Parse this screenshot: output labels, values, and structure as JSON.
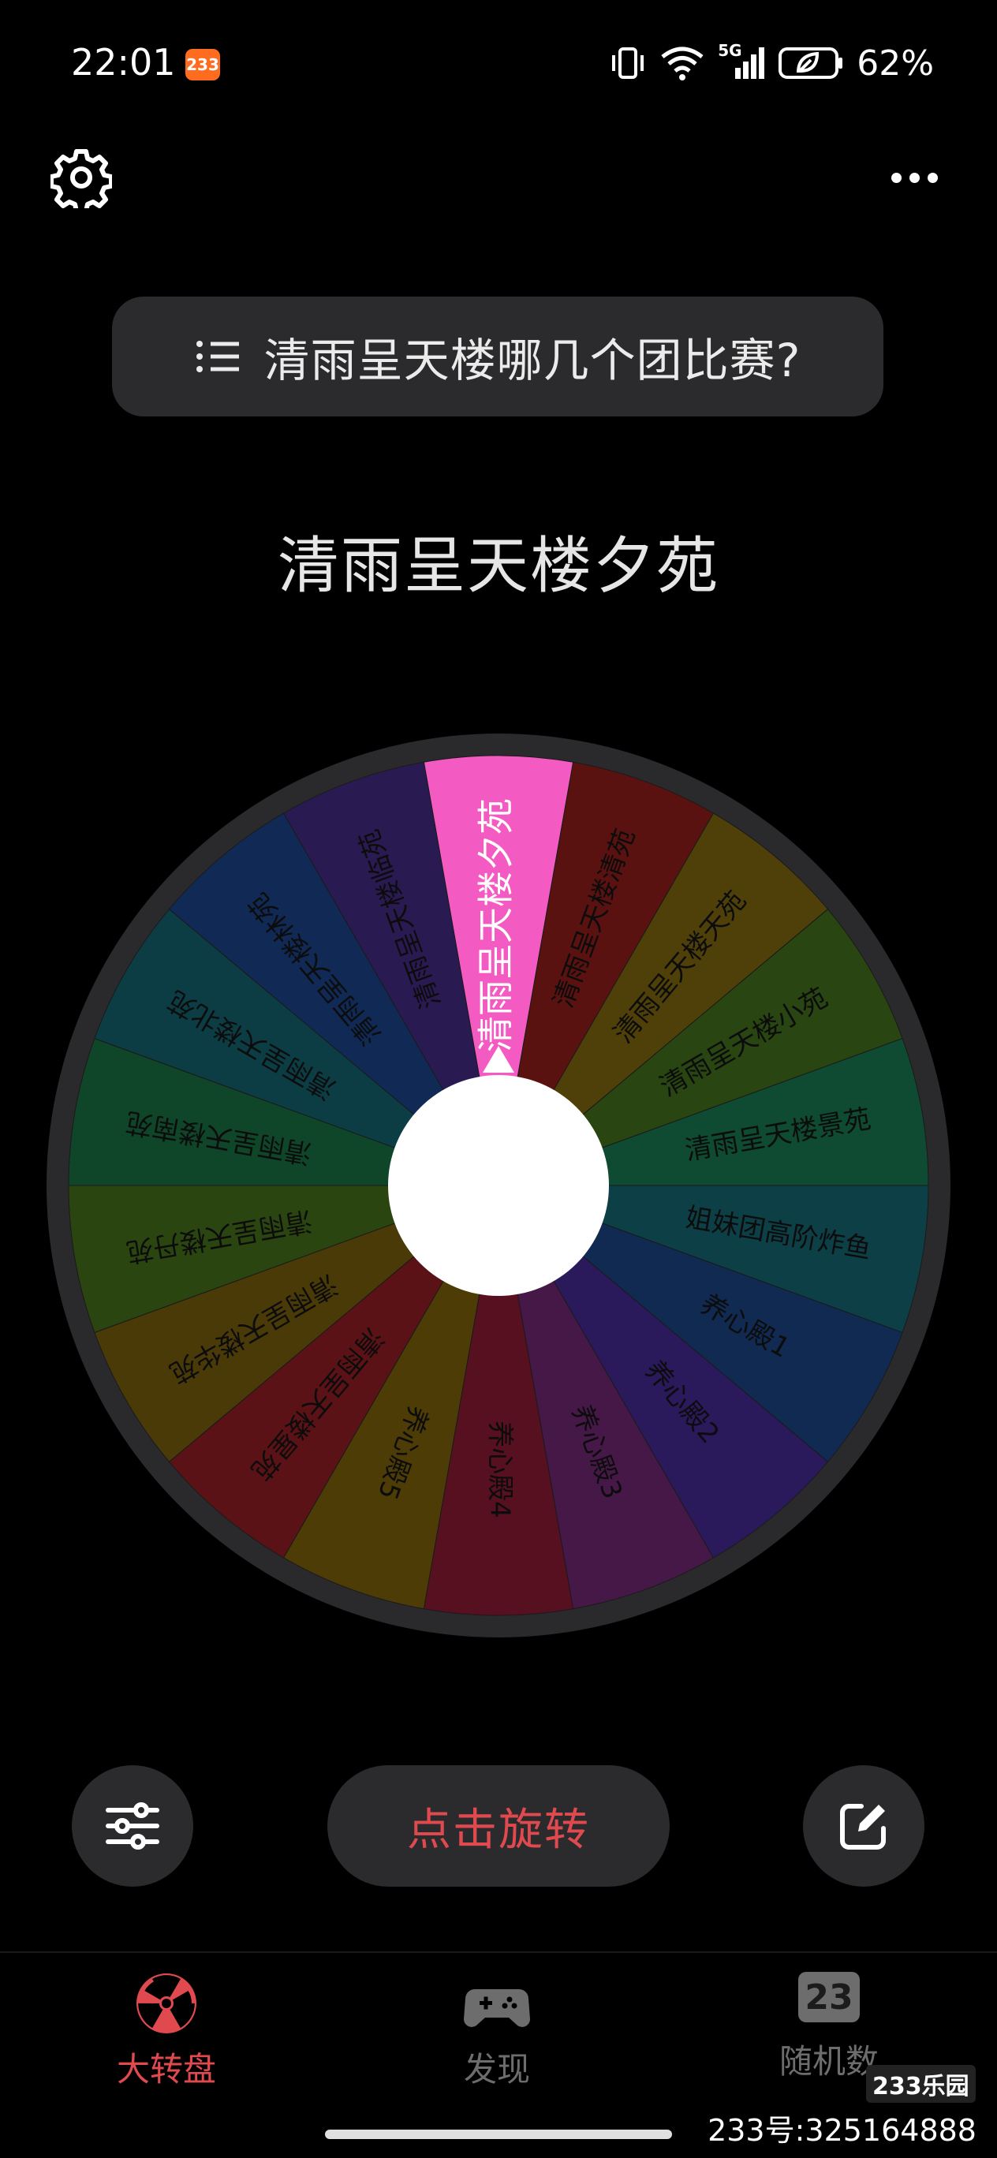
{
  "status_bar": {
    "time": "22:01",
    "app_badge": "233",
    "network": "5G",
    "battery": "62%"
  },
  "header": {
    "settings_icon": "gear-icon",
    "more_icon": "more-horizontal-icon"
  },
  "question": {
    "icon": "list-icon",
    "text": "清雨呈天楼哪几个团比赛?"
  },
  "result": "清雨呈天楼夕苑",
  "wheel": {
    "highlight_color": "#f35bc2",
    "segments": [
      {
        "label": "清雨呈天楼夕苑",
        "color": "#f35bc2",
        "text_color": "#ffffff",
        "highlighted": true
      },
      {
        "label": "清雨呈天楼清苑",
        "color": "#5a1210",
        "text_color": "#0c0c0c"
      },
      {
        "label": "清雨呈天楼天苑",
        "color": "#4e4008",
        "text_color": "#0c0c0c"
      },
      {
        "label": "清雨呈天楼小苑",
        "color": "#284512",
        "text_color": "#0c0c0c"
      },
      {
        "label": "清雨呈天楼景苑",
        "color": "#0f4a32",
        "text_color": "#0c0c0c"
      },
      {
        "label": "姐妹团高阶炸鱼",
        "color": "#0d3f47",
        "text_color": "#0c0c0c"
      },
      {
        "label": "养心殿1",
        "color": "#112a52",
        "text_color": "#0c0c0c"
      },
      {
        "label": "养心殿2",
        "color": "#2a1a5c",
        "text_color": "#0c0c0c"
      },
      {
        "label": "养心殿3",
        "color": "#461848",
        "text_color": "#0c0c0c"
      },
      {
        "label": "养心殿4",
        "color": "#561020",
        "text_color": "#0c0c0c"
      },
      {
        "label": "养心殿5",
        "color": "#4d3c06",
        "text_color": "#0c0c0c"
      },
      {
        "label": "清雨呈天楼星苑",
        "color": "#5a1216",
        "text_color": "#0c0c0c"
      },
      {
        "label": "清雨呈天楼华苑",
        "color": "#4a3a08",
        "text_color": "#0c0c0c"
      },
      {
        "label": "清雨呈天楼丹苑",
        "color": "#2b4510",
        "text_color": "#0c0c0c"
      },
      {
        "label": "清雨呈天楼南苑",
        "color": "#0f4528",
        "text_color": "#0c0c0c"
      },
      {
        "label": "清雨呈天楼北苑",
        "color": "#0c3d45",
        "text_color": "#0c0c0c"
      },
      {
        "label": "清雨呈天楼林苑",
        "color": "#102a55",
        "text_color": "#0c0c0c"
      },
      {
        "label": "清雨呈天楼临苑",
        "color": "#2a1a52",
        "text_color": "#0c0c0c"
      }
    ]
  },
  "controls": {
    "filter_icon": "sliders-icon",
    "spin_label": "点击旋转",
    "edit_icon": "edit-icon"
  },
  "tabs": [
    {
      "label": "大转盘",
      "icon": "radiation-icon",
      "active": true,
      "color": "#e04a4f"
    },
    {
      "label": "发现",
      "icon": "gamepad-icon",
      "active": false,
      "color": "#6d6d6d"
    },
    {
      "label": "随机数",
      "icon": "number-icon",
      "icon_text": "23",
      "active": false,
      "color": "#6d6d6d"
    }
  ],
  "watermark": {
    "logo": "233乐园",
    "id": "233号:325164888"
  }
}
